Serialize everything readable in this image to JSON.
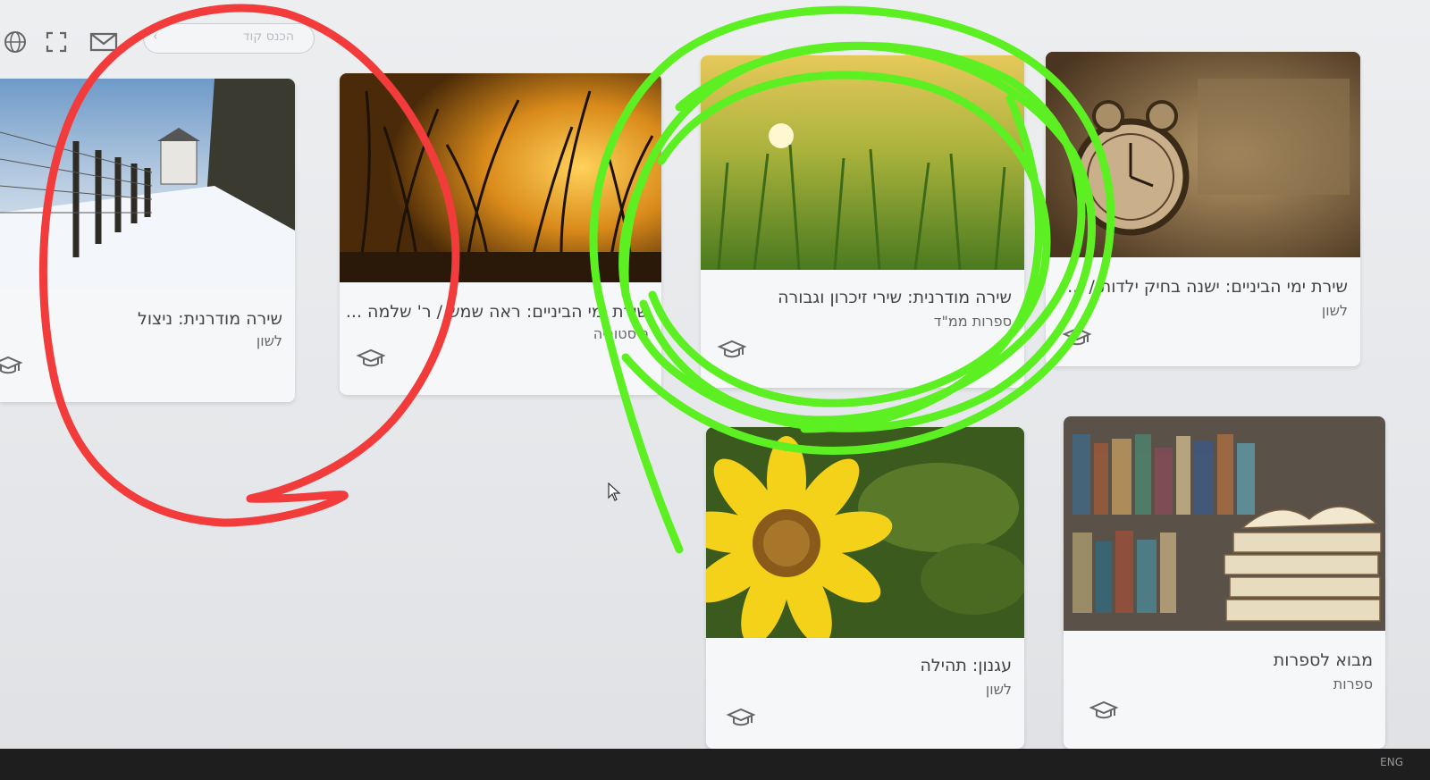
{
  "toolbar": {
    "search_placeholder": "הכנס קוד",
    "icons": [
      "globe-icon",
      "fullscreen-icon",
      "mail-icon",
      "chevron-left-icon"
    ]
  },
  "cards": [
    {
      "title": "שירת ימי הביניים: ישנה בחיק ילדות / ...",
      "subject": "לשון"
    },
    {
      "title": "שירה מודרנית: שירי זיכרון וגבורה",
      "subject": "ספרות ממ\"ד"
    },
    {
      "title": "שירת ימי הביניים: ראה שמש / ר' שלמה ...",
      "subject": "היסטוריה"
    },
    {
      "title": "שירה מודרנית: ניצול",
      "subject": "לשון"
    },
    {
      "title": "מבוא לספרות",
      "subject": "ספרות"
    },
    {
      "title": "עגנון: תהילה",
      "subject": "לשון"
    }
  ],
  "taskbar": {
    "label": "ENG"
  },
  "colors": {
    "annotation_red": "#f23b3b",
    "annotation_green": "#5cf022"
  }
}
